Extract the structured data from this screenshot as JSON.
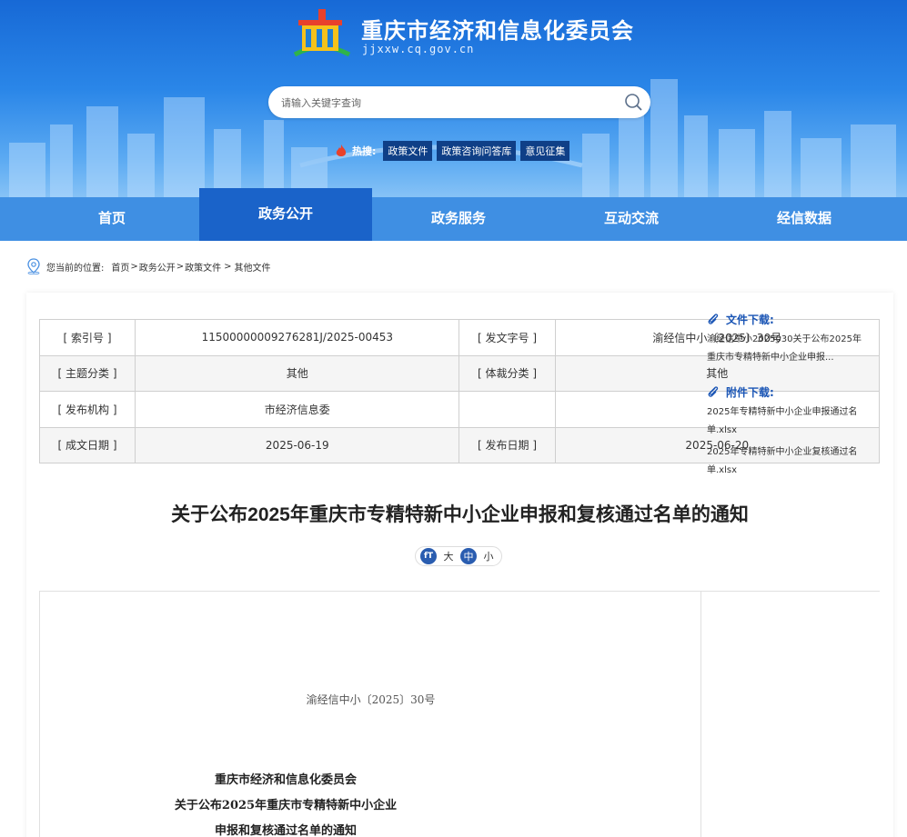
{
  "header": {
    "site_title": "重庆市经济和信息化委员会",
    "site_domain": "jjxxw.cq.gov.cn",
    "search_placeholder": "请输入关键字查询",
    "hot_label": "热搜:",
    "hot_tags": [
      "政策文件",
      "政策咨询问答库",
      "意见征集"
    ]
  },
  "nav": {
    "items": [
      "首页",
      "政务公开",
      "政务服务",
      "互动交流",
      "经信数据"
    ],
    "active": "政务公开"
  },
  "breadcrumb": {
    "prefix": "您当前的位置:",
    "items": [
      "首页",
      "政务公开",
      "政策文件",
      "其他文件"
    ],
    "sep": ">"
  },
  "meta_table": {
    "rows": [
      [
        "[ 索引号 ]",
        "11500000009276281J/2025-00453",
        "[ 发文字号 ]",
        "渝经信中小〔2025〕30号"
      ],
      [
        "[ 主题分类 ]",
        "其他",
        "[ 体裁分类 ]",
        "其他"
      ],
      [
        "[ 发布机构 ]",
        "市经济信息委",
        "",
        ""
      ],
      [
        "[ 成文日期 ]",
        "2025-06-19",
        "[ 发布日期 ]",
        "2025-06-20"
      ]
    ]
  },
  "document": {
    "title": "关于公布2025年重庆市专精特新中小企业申报和复核通过名单的通知",
    "font_size": {
      "icon": "fT",
      "large": "大",
      "medium": "中",
      "small": "小",
      "selected": "中"
    },
    "doc_number": "渝经信中小〔2025〕30号",
    "heading_lines": [
      "重庆市经济和信息化委员会",
      "关于公布2025年重庆市专精特新中小企业",
      "申报和复核通过名单的通知"
    ]
  },
  "sidebar": {
    "file_download_label": "文件下载:",
    "files": [
      "渝经信中小2025030关于公布2025年重庆市专精特新中小企业申报..."
    ],
    "attachment_download_label": "附件下载:",
    "attachments": [
      "2025年专精特新中小企业申报通过名单.xlsx",
      "2025年专精特新中小企业复核通过名单.xlsx"
    ]
  },
  "colors": {
    "header_blue": "#1769d6",
    "nav_blue": "#3f8fe3",
    "nav_active": "#1a63c9",
    "tag_dark": "#0f3f87",
    "link_blue": "#1a55b5"
  }
}
